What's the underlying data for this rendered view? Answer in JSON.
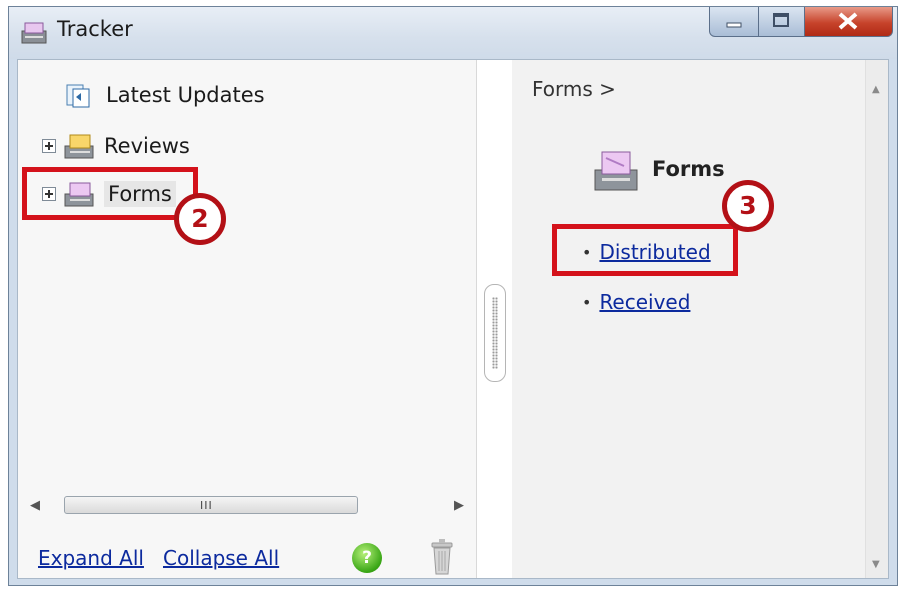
{
  "window": {
    "title": "Tracker",
    "icons": {
      "app": "tracker-app-icon",
      "minimize": "minimize-icon",
      "maximize": "maximize-icon",
      "close": "close-icon"
    }
  },
  "tree": {
    "items": [
      {
        "label": "Latest Updates",
        "icon": "latest-updates-icon",
        "expandable": false
      },
      {
        "label": "Reviews",
        "icon": "reviews-icon",
        "expandable": true
      },
      {
        "label": "Forms",
        "icon": "forms-icon",
        "expandable": true,
        "selected": true
      }
    ]
  },
  "footer": {
    "expand_all": "Expand All",
    "collapse_all": "Collapse All",
    "help_symbol": "?"
  },
  "right": {
    "breadcrumb": "Forms >",
    "section_title": "Forms",
    "links": [
      "Distributed",
      "Received"
    ]
  },
  "annotations": {
    "step2": "2",
    "step3": "3",
    "color": "#d4121b"
  }
}
